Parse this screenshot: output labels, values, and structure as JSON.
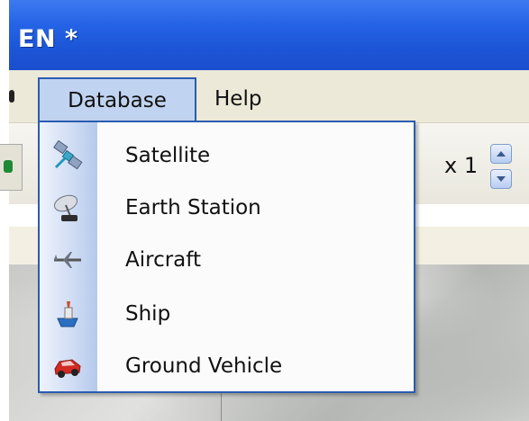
{
  "window": {
    "title": "EN *"
  },
  "menubar": {
    "items": [
      {
        "label": "Database",
        "active": true
      },
      {
        "label": "Help",
        "active": false
      }
    ]
  },
  "toolbar": {
    "zoom_label": "x 1"
  },
  "dropdown": {
    "items": [
      {
        "label": "Satellite",
        "icon": "satellite-icon"
      },
      {
        "label": "Earth Station",
        "icon": "earth-station-icon"
      },
      {
        "label": "Aircraft",
        "icon": "aircraft-icon"
      },
      {
        "label": "Ship",
        "icon": "ship-icon"
      },
      {
        "label": "Ground Vehicle",
        "icon": "ground-vehicle-icon"
      }
    ]
  },
  "colors": {
    "titlebar": "#2563e6",
    "menu_highlight": "#c0d3f0",
    "menu_border": "#2a5cb0"
  }
}
